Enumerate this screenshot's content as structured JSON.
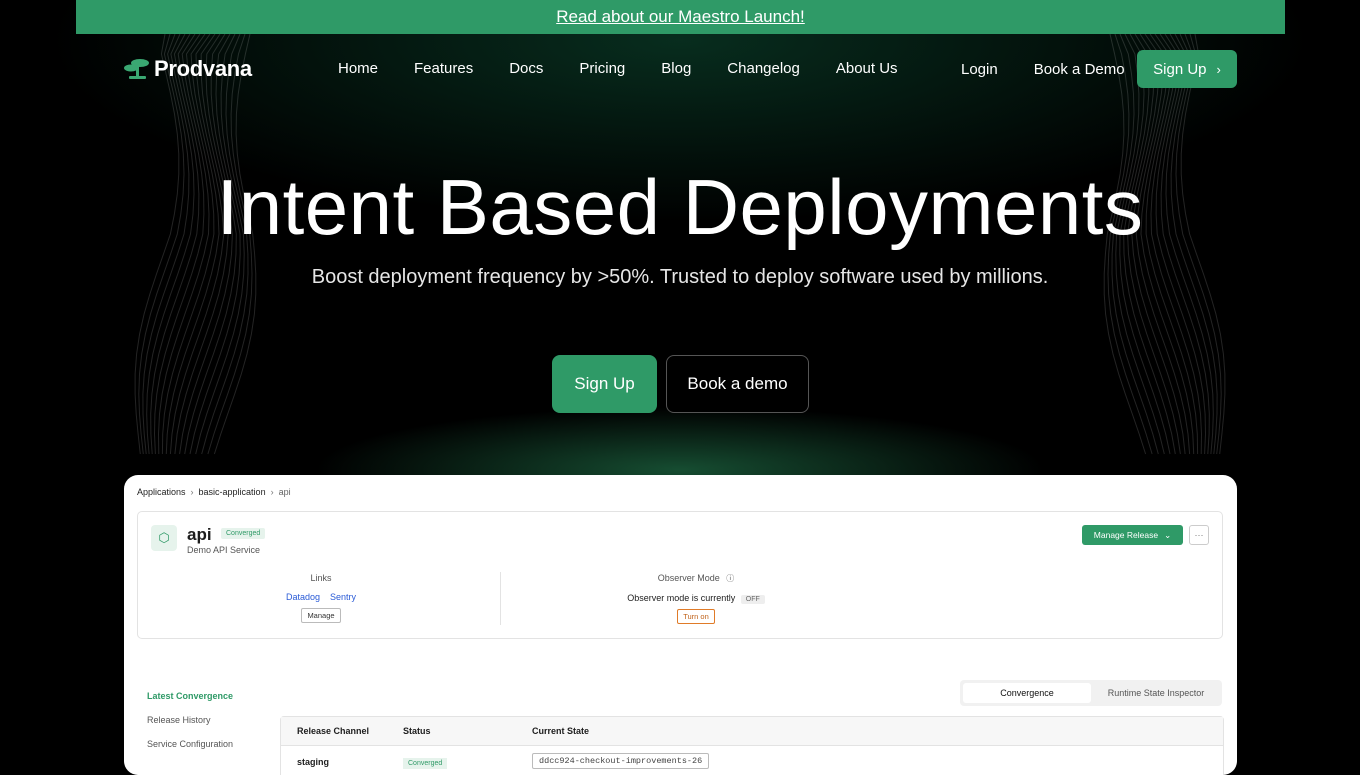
{
  "banner": {
    "text": "Read about our Maestro Launch!"
  },
  "nav": {
    "brand": "Prodvana",
    "links": [
      "Home",
      "Features",
      "Docs",
      "Pricing",
      "Blog",
      "Changelog",
      "About Us"
    ],
    "login": "Login",
    "book_demo": "Book a Demo",
    "signup": "Sign Up",
    "signup_chevron": "›"
  },
  "hero": {
    "title": "Intent Based Deployments",
    "subtitle": "Boost deployment frequency by >50%. Trusted to deploy software used by millions.",
    "cta_primary": "Sign Up",
    "cta_secondary": "Book a demo"
  },
  "app": {
    "breadcrumb": [
      "Applications",
      "basic-application",
      "api"
    ],
    "service": {
      "name": "api",
      "status": "Converged",
      "description": "Demo API Service",
      "manage_release": "Manage Release",
      "more": "···"
    },
    "links": {
      "title": "Links",
      "items": [
        "Datadog",
        "Sentry"
      ],
      "manage": "Manage"
    },
    "observer": {
      "title": "Observer Mode",
      "text": "Observer mode is currently",
      "state": "OFF",
      "turn_on": "Turn on"
    },
    "side_nav": [
      "Latest Convergence",
      "Release History",
      "Service Configuration"
    ],
    "tabs": [
      "Convergence",
      "Runtime State Inspector"
    ],
    "table": {
      "headers": [
        "Release Channel",
        "Status",
        "Current State"
      ],
      "rows": [
        {
          "channel": "staging",
          "status": "Converged",
          "state": "ddcc924-checkout-improvements-26"
        }
      ]
    }
  },
  "colors": {
    "accent": "#2f9a67",
    "background": "#000000",
    "link": "#2a5bd7"
  }
}
